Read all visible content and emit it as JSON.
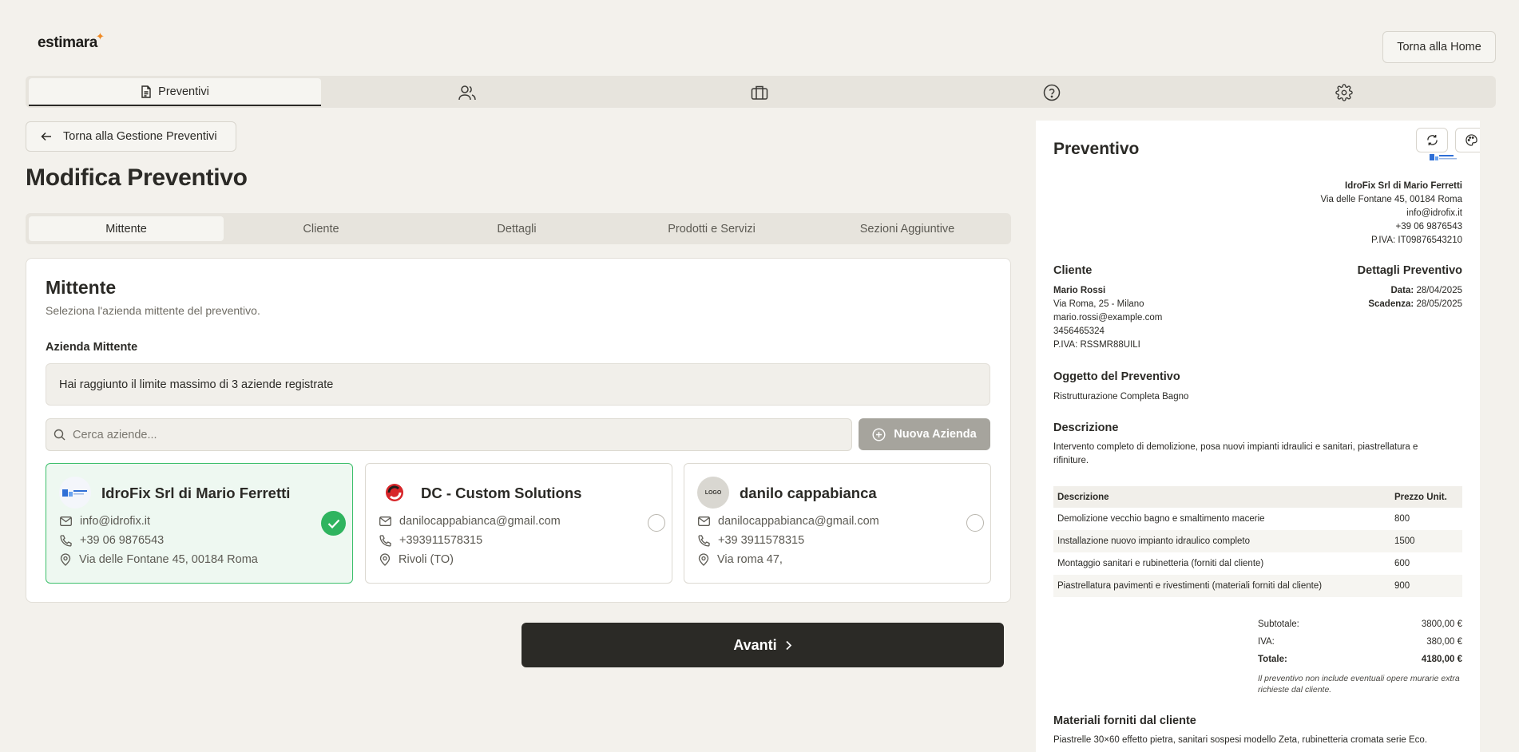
{
  "app": {
    "logo": "estimara",
    "logo_spark": "✦",
    "home_button": "Torna alla Home"
  },
  "topnav": {
    "tabs": [
      {
        "label": "Preventivi",
        "icon": "document-icon",
        "active": true
      },
      {
        "label": "",
        "icon": "users-icon"
      },
      {
        "label": "",
        "icon": "briefcase-icon"
      },
      {
        "label": "",
        "icon": "help-circle-icon"
      },
      {
        "label": "",
        "icon": "gear-icon"
      }
    ]
  },
  "back_button": "Torna alla Gestione Preventivi",
  "page_title": "Modifica Preventivo",
  "steps": [
    "Mittente",
    "Cliente",
    "Dettagli",
    "Prodotti e Servizi",
    "Sezioni Aggiuntive"
  ],
  "mittente": {
    "title": "Mittente",
    "subtitle": "Seleziona l'azienda mittente del preventivo.",
    "field_label": "Azienda Mittente",
    "limit_message": "Hai raggiunto il limite massimo di 3 aziende registrate",
    "search_placeholder": "Cerca aziende...",
    "new_company_button": "Nuova Azienda",
    "companies": [
      {
        "name": "IdroFix Srl di Mario Ferretti",
        "email": "info@idrofix.it",
        "phone": "+39 06 9876543",
        "address": "Via delle Fontane 45, 00184 Roma",
        "selected": true
      },
      {
        "name": "DC - Custom Solutions",
        "email": "danilocappabianca@gmail.com",
        "phone": "+393911578315",
        "address": "Rivoli (TO)",
        "selected": false
      },
      {
        "name": "danilo cappabianca",
        "email": "danilocappabianca@gmail.com",
        "phone": "+39 3911578315",
        "address": "Via roma 47,",
        "selected": false,
        "logo_text": "LOGO"
      }
    ]
  },
  "next_button": "Avanti",
  "preview": {
    "title": "Preventivo",
    "sender": {
      "name": "IdroFix Srl di Mario Ferretti",
      "address": "Via delle Fontane 45, 00184 Roma",
      "email": "info@idrofix.it",
      "phone": "+39 06 9876543",
      "vat": "P.IVA: IT09876543210"
    },
    "client_heading": "Cliente",
    "client": {
      "name": "Mario Rossi",
      "address": "Via Roma, 25 - Milano",
      "email": "mario.rossi@example.com",
      "phone": "3456465324",
      "vat": "P.IVA: RSSMR88UILI"
    },
    "details_heading": "Dettagli Preventivo",
    "date_label": "Data:",
    "date": "28/04/2025",
    "expiry_label": "Scadenza:",
    "expiry": "28/05/2025",
    "subject_heading": "Oggetto del Preventivo",
    "subject": "Ristrutturazione Completa Bagno",
    "description_heading": "Descrizione",
    "description": "Intervento completo di demolizione, posa nuovi impianti idraulici e sanitari, piastrellatura e rifiniture.",
    "table": {
      "headers": [
        "Descrizione",
        "Prezzo Unit."
      ],
      "rows": [
        [
          "Demolizione vecchio bagno e smaltimento macerie",
          "800"
        ],
        [
          "Installazione nuovo impianto idraulico completo",
          "1500"
        ],
        [
          "Montaggio sanitari e rubinetteria (forniti dal cliente)",
          "600"
        ],
        [
          "Piastrellatura pavimenti e rivestimenti (materiali forniti dal cliente)",
          "900"
        ]
      ]
    },
    "totals": {
      "subtotal_label": "Subtotale:",
      "subtotal": "3800,00 €",
      "vat_label": "IVA:",
      "vat": "380,00 €",
      "total_label": "Totale:",
      "total": "4180,00 €"
    },
    "note": "Il preventivo non include eventuali opere murarie extra richieste dal cliente.",
    "materials_heading": "Materiali forniti dal cliente",
    "materials": "Piastrelle 30×60 effetto pietra, sanitari sospesi modello Zeta, rubinetteria cromata serie Eco."
  }
}
